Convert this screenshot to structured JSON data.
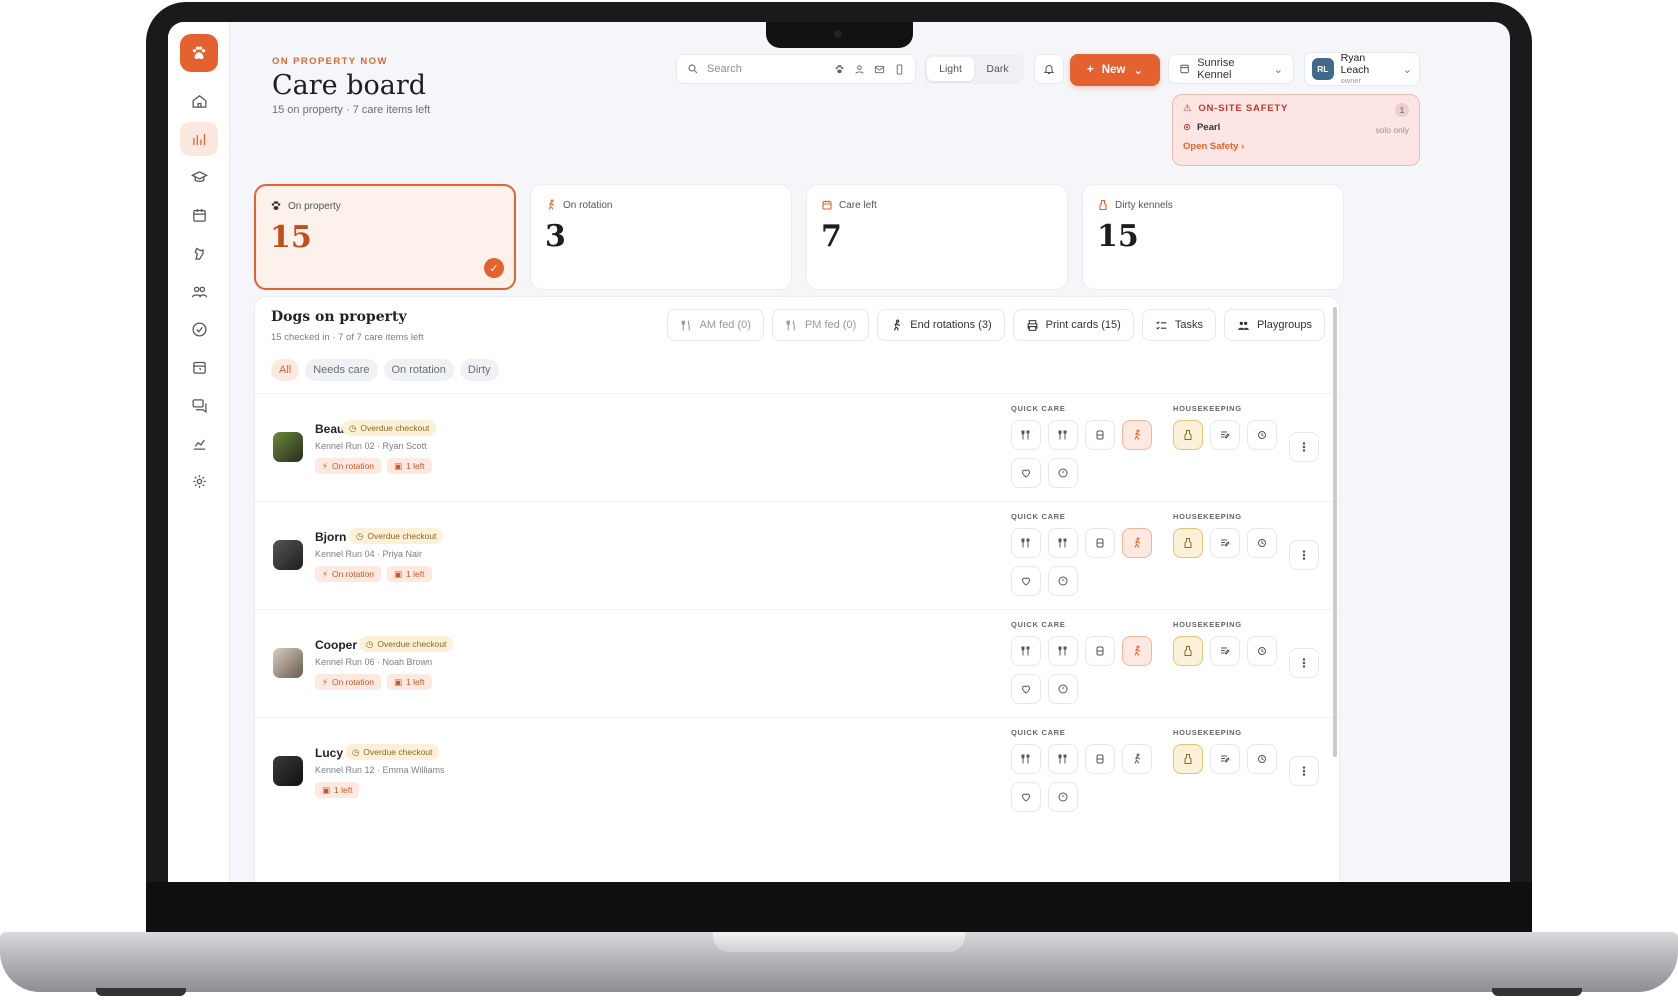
{
  "header": {
    "kicker": "ON PROPERTY NOW",
    "title": "Care board",
    "subtitle": "15 on property · 7 care items left"
  },
  "search": {
    "placeholder": "Search"
  },
  "theme": {
    "light": "Light",
    "dark": "Dark"
  },
  "new_button": "New",
  "kennel_label": "Sunrise Kennel",
  "user": {
    "initials": "RL",
    "name": "Ryan Leach",
    "role": "owner"
  },
  "safety": {
    "title": "ON-SITE SAFETY",
    "count": "1",
    "pet": "Pearl",
    "note": "solo only",
    "link": "Open Safety"
  },
  "stats": [
    {
      "label": "On property",
      "value": "15"
    },
    {
      "label": "On rotation",
      "value": "3"
    },
    {
      "label": "Care left",
      "value": "7"
    },
    {
      "label": "Dirty kennels",
      "value": "15"
    }
  ],
  "panel": {
    "title": "Dogs on property",
    "subtitle": "15 checked in · 7 of 7 care items left",
    "tools": [
      "AM fed (0)",
      "PM fed (0)",
      "End rotations (3)",
      "Print cards (15)",
      "Tasks",
      "Playgroups"
    ],
    "filters": [
      "All",
      "Needs care",
      "On rotation",
      "Dirty"
    ]
  },
  "labels": {
    "quick_care": "QUICK CARE",
    "housekeeping": "HOUSEKEEPING"
  },
  "dogs": [
    {
      "name": "Beau",
      "badge": "Overdue checkout",
      "meta": "Kennel Run 02 · Ryan Scott",
      "rotation": "On rotation",
      "left": "1 left"
    },
    {
      "name": "Bjorn",
      "badge": "Overdue checkout",
      "meta": "Kennel Run 04 · Priya Nair",
      "rotation": "On rotation",
      "left": "1 left"
    },
    {
      "name": "Cooper",
      "badge": "Overdue checkout",
      "meta": "Kennel Run 06 · Noah Brown",
      "rotation": "On rotation",
      "left": "1 left"
    },
    {
      "name": "Lucy",
      "badge": "Overdue checkout",
      "meta": "Kennel Run 12 · Emma Williams",
      "rotation": "",
      "left": "1 left"
    }
  ],
  "colors": {
    "accent": "#e4622f",
    "warning": "#fbf0d8",
    "danger": "#c0392b"
  }
}
